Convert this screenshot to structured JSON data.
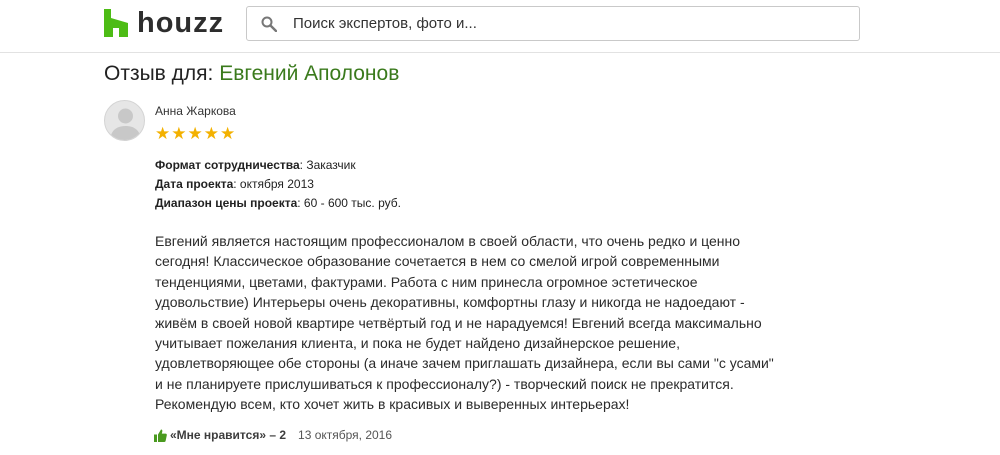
{
  "header": {
    "logo_text": "houzz",
    "search_placeholder": "Поиск экспертов, фото и..."
  },
  "page": {
    "title_prefix": "Отзыв для:",
    "title_name": "Евгений Аполонов"
  },
  "review": {
    "reviewer_name": "Анна Жаркова",
    "rating": 5,
    "stars": [
      "★",
      "★",
      "★",
      "★",
      "★"
    ],
    "meta": [
      {
        "label": "Формат сотрудничества",
        "value": ": Заказчик"
      },
      {
        "label": "Дата проекта",
        "value": ": октября 2013"
      },
      {
        "label": "Диапазон цены проекта",
        "value": ": 60 - 600 тыс. руб."
      }
    ],
    "text_lines": [
      "Евгений является настоящим профессионалом в своей области, что очень редко и ценно",
      "сегодня! Классическое образование сочетается в нем со смелой игрой современными",
      "тенденциями, цветами, фактурами. Работа с ним принесла огромное эстетическое",
      "удовольствие) Интерьеры очень декоративны, комфортны глазу и никогда не надоедают -",
      "живём в своей новой квартире четвёртый год и не нарадуемся! Евгений всегда максимально",
      "учитывает пожелания клиента, и пока не будет найдено дизайнерское решение,",
      "удовлетворяющее обе стороны (а иначе зачем приглашать дизайнера, если вы сами \"с усами\"",
      "и не планируете прислушиваться к профессионалу?) - творческий поиск не прекратится.",
      "Рекомендую всем, кто хочет жить в красивых и выверенных интерьерах!"
    ],
    "like_label": "«Мне нравится» – 2",
    "date": "13 октября, 2016"
  },
  "colors": {
    "brand_green": "#4dbc15",
    "name_green": "#3a7a1c",
    "star_color": "#f3b100"
  }
}
